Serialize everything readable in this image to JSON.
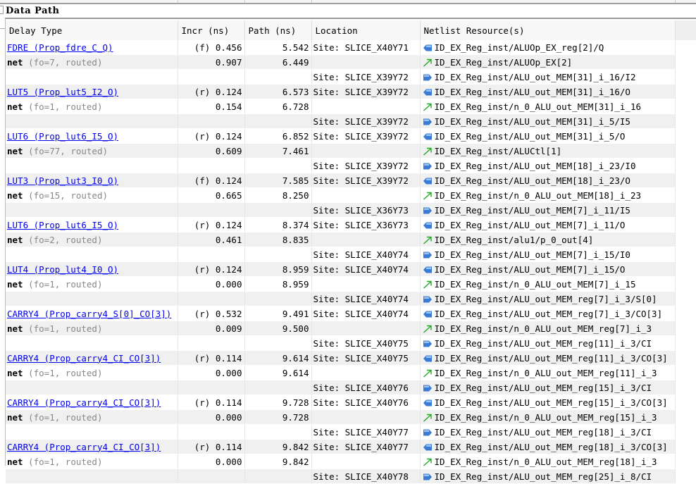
{
  "section_title": "Data Path",
  "columns": [
    "Delay Type",
    "Incr (ns)",
    "Path (ns)",
    "Location",
    "Netlist Resource(s)"
  ],
  "colors": {
    "link": "#0000ee",
    "pin": "#3a7bd5",
    "net_arrow": "#22aa22",
    "row_alt": "#f0f0f0"
  },
  "rows": [
    {
      "type": "cell",
      "delay": "FDRE (Prop_fdre_C_Q)",
      "edge": "(f)",
      "incr": "0.456",
      "path": "5.542",
      "location": "Site: SLICE_X40Y71",
      "icon": "output-pin-icon",
      "resource": "ID_EX_Reg_inst/ALUOp_EX_reg[2]/Q"
    },
    {
      "type": "net",
      "delay": "net",
      "detail": "(fo=7, routed)",
      "incr": "0.907",
      "path": "6.449",
      "location": "",
      "icon": "net-arrow-icon",
      "resource": "ID_EX_Reg_inst/ALUOp_EX[2]"
    },
    {
      "type": "site",
      "location": "Site: SLICE_X39Y72",
      "icon": "input-pin-icon",
      "resource": "ID_EX_Reg_inst/ALU_out_MEM[31]_i_16/I2"
    },
    {
      "type": "cell",
      "delay": "LUT5 (Prop_lut5_I2_O)",
      "edge": "(r)",
      "incr": "0.124",
      "path": "6.573",
      "location": "Site: SLICE_X39Y72",
      "icon": "output-pin-icon",
      "resource": "ID_EX_Reg_inst/ALU_out_MEM[31]_i_16/O"
    },
    {
      "type": "net",
      "delay": "net",
      "detail": "(fo=1, routed)",
      "incr": "0.154",
      "path": "6.728",
      "location": "",
      "icon": "net-arrow-icon",
      "resource": "ID_EX_Reg_inst/n_0_ALU_out_MEM[31]_i_16"
    },
    {
      "type": "site",
      "location": "Site: SLICE_X39Y72",
      "icon": "input-pin-icon",
      "resource": "ID_EX_Reg_inst/ALU_out_MEM[31]_i_5/I5"
    },
    {
      "type": "cell",
      "delay": "LUT6 (Prop_lut6_I5_O)",
      "edge": "(r)",
      "incr": "0.124",
      "path": "6.852",
      "location": "Site: SLICE_X39Y72",
      "icon": "output-pin-icon",
      "resource": "ID_EX_Reg_inst/ALU_out_MEM[31]_i_5/O"
    },
    {
      "type": "net",
      "delay": "net",
      "detail": "(fo=77, routed)",
      "incr": "0.609",
      "path": "7.461",
      "location": "",
      "icon": "net-arrow-icon",
      "resource": "ID_EX_Reg_inst/ALUCtl[1]"
    },
    {
      "type": "site",
      "location": "Site: SLICE_X39Y72",
      "icon": "input-pin-icon",
      "resource": "ID_EX_Reg_inst/ALU_out_MEM[18]_i_23/I0"
    },
    {
      "type": "cell",
      "delay": "LUT3 (Prop_lut3_I0_O)",
      "edge": "(f)",
      "incr": "0.124",
      "path": "7.585",
      "location": "Site: SLICE_X39Y72",
      "icon": "output-pin-icon",
      "resource": "ID_EX_Reg_inst/ALU_out_MEM[18]_i_23/O"
    },
    {
      "type": "net",
      "delay": "net",
      "detail": "(fo=15, routed)",
      "incr": "0.665",
      "path": "8.250",
      "location": "",
      "icon": "net-arrow-icon",
      "resource": "ID_EX_Reg_inst/n_0_ALU_out_MEM[18]_i_23"
    },
    {
      "type": "site",
      "location": "Site: SLICE_X36Y73",
      "icon": "input-pin-icon",
      "resource": "ID_EX_Reg_inst/ALU_out_MEM[7]_i_11/I5"
    },
    {
      "type": "cell",
      "delay": "LUT6 (Prop_lut6_I5_O)",
      "edge": "(r)",
      "incr": "0.124",
      "path": "8.374",
      "location": "Site: SLICE_X36Y73",
      "icon": "output-pin-icon",
      "resource": "ID_EX_Reg_inst/ALU_out_MEM[7]_i_11/O"
    },
    {
      "type": "net",
      "delay": "net",
      "detail": "(fo=2, routed)",
      "incr": "0.461",
      "path": "8.835",
      "location": "",
      "icon": "net-arrow-icon",
      "resource": "ID_EX_Reg_inst/alu1/p_0_out[4]"
    },
    {
      "type": "site",
      "location": "Site: SLICE_X40Y74",
      "icon": "input-pin-icon",
      "resource": "ID_EX_Reg_inst/ALU_out_MEM[7]_i_15/I0"
    },
    {
      "type": "cell",
      "delay": "LUT4 (Prop_lut4_I0_O)",
      "edge": "(r)",
      "incr": "0.124",
      "path": "8.959",
      "location": "Site: SLICE_X40Y74",
      "icon": "output-pin-icon",
      "resource": "ID_EX_Reg_inst/ALU_out_MEM[7]_i_15/O"
    },
    {
      "type": "net",
      "delay": "net",
      "detail": "(fo=1, routed)",
      "incr": "0.000",
      "path": "8.959",
      "location": "",
      "icon": "net-arrow-icon",
      "resource": "ID_EX_Reg_inst/n_0_ALU_out_MEM[7]_i_15"
    },
    {
      "type": "site",
      "location": "Site: SLICE_X40Y74",
      "icon": "input-pin-icon",
      "resource": "ID_EX_Reg_inst/ALU_out_MEM_reg[7]_i_3/S[0]"
    },
    {
      "type": "cell",
      "delay": "CARRY4 (Prop_carry4_S[0]_CO[3])",
      "edge": "(r)",
      "incr": "0.532",
      "path": "9.491",
      "location": "Site: SLICE_X40Y74",
      "icon": "output-pin-icon",
      "resource": "ID_EX_Reg_inst/ALU_out_MEM_reg[7]_i_3/CO[3]"
    },
    {
      "type": "net",
      "delay": "net",
      "detail": "(fo=1, routed)",
      "incr": "0.009",
      "path": "9.500",
      "location": "",
      "icon": "net-arrow-icon",
      "resource": "ID_EX_Reg_inst/n_0_ALU_out_MEM_reg[7]_i_3"
    },
    {
      "type": "site",
      "location": "Site: SLICE_X40Y75",
      "icon": "input-pin-icon",
      "resource": "ID_EX_Reg_inst/ALU_out_MEM_reg[11]_i_3/CI"
    },
    {
      "type": "cell",
      "delay": "CARRY4 (Prop_carry4_CI_CO[3])",
      "edge": "(r)",
      "incr": "0.114",
      "path": "9.614",
      "location": "Site: SLICE_X40Y75",
      "icon": "output-pin-icon",
      "resource": "ID_EX_Reg_inst/ALU_out_MEM_reg[11]_i_3/CO[3]"
    },
    {
      "type": "net",
      "delay": "net",
      "detail": "(fo=1, routed)",
      "incr": "0.000",
      "path": "9.614",
      "location": "",
      "icon": "net-arrow-icon",
      "resource": "ID_EX_Reg_inst/n_0_ALU_out_MEM_reg[11]_i_3"
    },
    {
      "type": "site",
      "location": "Site: SLICE_X40Y76",
      "icon": "input-pin-icon",
      "resource": "ID_EX_Reg_inst/ALU_out_MEM_reg[15]_i_3/CI"
    },
    {
      "type": "cell",
      "delay": "CARRY4 (Prop_carry4_CI_CO[3])",
      "edge": "(r)",
      "incr": "0.114",
      "path": "9.728",
      "location": "Site: SLICE_X40Y76",
      "icon": "output-pin-icon",
      "resource": "ID_EX_Reg_inst/ALU_out_MEM_reg[15]_i_3/CO[3]"
    },
    {
      "type": "net",
      "delay": "net",
      "detail": "(fo=1, routed)",
      "incr": "0.000",
      "path": "9.728",
      "location": "",
      "icon": "net-arrow-icon",
      "resource": "ID_EX_Reg_inst/n_0_ALU_out_MEM_reg[15]_i_3"
    },
    {
      "type": "site",
      "location": "Site: SLICE_X40Y77",
      "icon": "input-pin-icon",
      "resource": "ID_EX_Reg_inst/ALU_out_MEM_reg[18]_i_3/CI"
    },
    {
      "type": "cell",
      "delay": "CARRY4 (Prop_carry4_CI_CO[3])",
      "edge": "(r)",
      "incr": "0.114",
      "path": "9.842",
      "location": "Site: SLICE_X40Y77",
      "icon": "output-pin-icon",
      "resource": "ID_EX_Reg_inst/ALU_out_MEM_reg[18]_i_3/CO[3]"
    },
    {
      "type": "net",
      "delay": "net",
      "detail": "(fo=1, routed)",
      "incr": "0.000",
      "path": "9.842",
      "location": "",
      "icon": "net-arrow-icon",
      "resource": "ID_EX_Reg_inst/n_0_ALU_out_MEM_reg[18]_i_3"
    },
    {
      "type": "site",
      "location": "Site: SLICE_X40Y78",
      "icon": "input-pin-icon",
      "resource": "ID_EX_Reg_inst/ALU_out_MEM_reg[25]_i_8/CI"
    }
  ]
}
